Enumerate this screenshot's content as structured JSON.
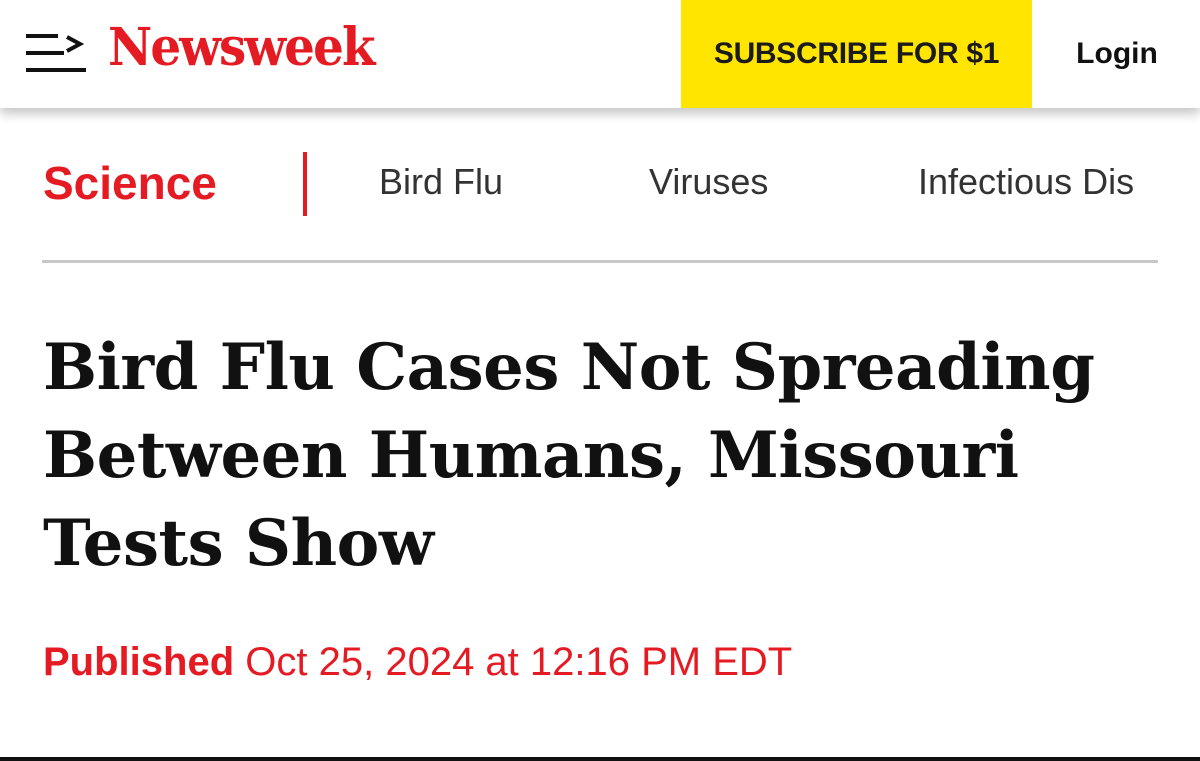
{
  "header": {
    "menu_icon": "menu-arrow-icon",
    "logo_text": "Newsweek",
    "subscribe_label": "SUBSCRIBE FOR $1",
    "login_label": "Login"
  },
  "subnav": {
    "section": "Science",
    "items": [
      "Bird Flu",
      "Viruses",
      "Infectious Dis"
    ]
  },
  "article": {
    "headline": "Bird Flu Cases Not Spreading Between Humans, Missouri Tests Show",
    "published_label": "Published",
    "published_date": "Oct 25, 2024 at 12:16 PM EDT"
  },
  "colors": {
    "brand_red": "#e51b23",
    "subscribe_yellow": "#ffe500",
    "text_dark": "#111111",
    "nav_gray": "#333333",
    "rule_gray": "#c8c8c8"
  }
}
